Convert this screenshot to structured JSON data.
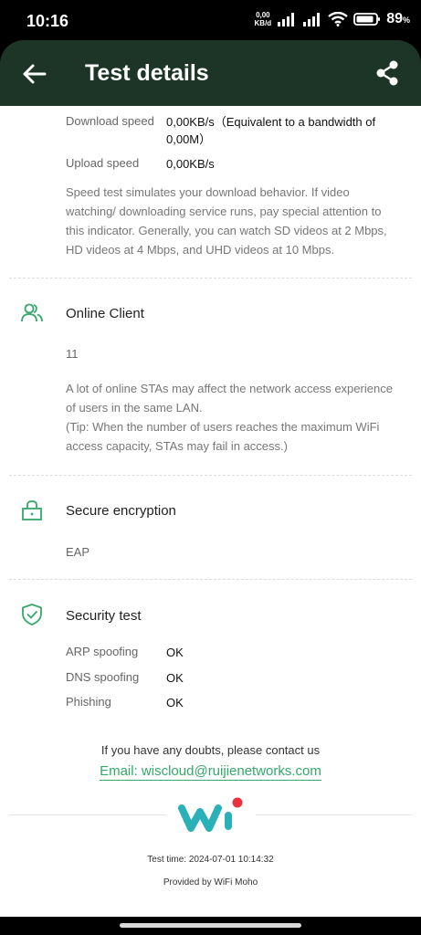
{
  "status": {
    "time": "10:16",
    "net_speed_value": "0,00",
    "net_speed_unit": "KB/d",
    "battery": "89",
    "battery_unit": "%"
  },
  "header": {
    "title": "Test details"
  },
  "speed": {
    "download_label": "Download speed",
    "download_value": "0,00KB/s（Equivalent to a bandwidth of 0,00M）",
    "upload_label": "Upload speed",
    "upload_value": "0,00KB/s",
    "description": "Speed test simulates your download behavior. If video watching/ downloading service runs, pay special attention to this indicator. Generally, you can watch SD videos at 2 Mbps, HD videos at 4 Mbps, and UHD videos at 10 Mbps."
  },
  "online_client": {
    "title": "Online Client",
    "count": "11",
    "note_line1": "A lot of online STAs may affect the network access experience of users in the same LAN.",
    "note_line2": "(Tip: When the number of users reaches the maximum WiFi access capacity, STAs may fail in access.)"
  },
  "encryption": {
    "title": "Secure encryption",
    "value": "EAP"
  },
  "security": {
    "title": "Security test",
    "rows": [
      {
        "label": "ARP spoofing",
        "value": "OK"
      },
      {
        "label": "DNS spoofing",
        "value": "OK"
      },
      {
        "label": "Phishing",
        "value": "OK"
      }
    ]
  },
  "footer": {
    "contact_text": "If you have any doubts, please contact us",
    "email": "Email: wiscloud@ruijienetworks.com",
    "test_time": "Test time: 2024-07-01 10:14:32",
    "provided_by": "Provided by WiFi Moho"
  },
  "colors": {
    "header_bg": "#1c3527",
    "accent": "#35a86a",
    "logo_teal": "#2ab0b8",
    "logo_red": "#e8323c"
  }
}
